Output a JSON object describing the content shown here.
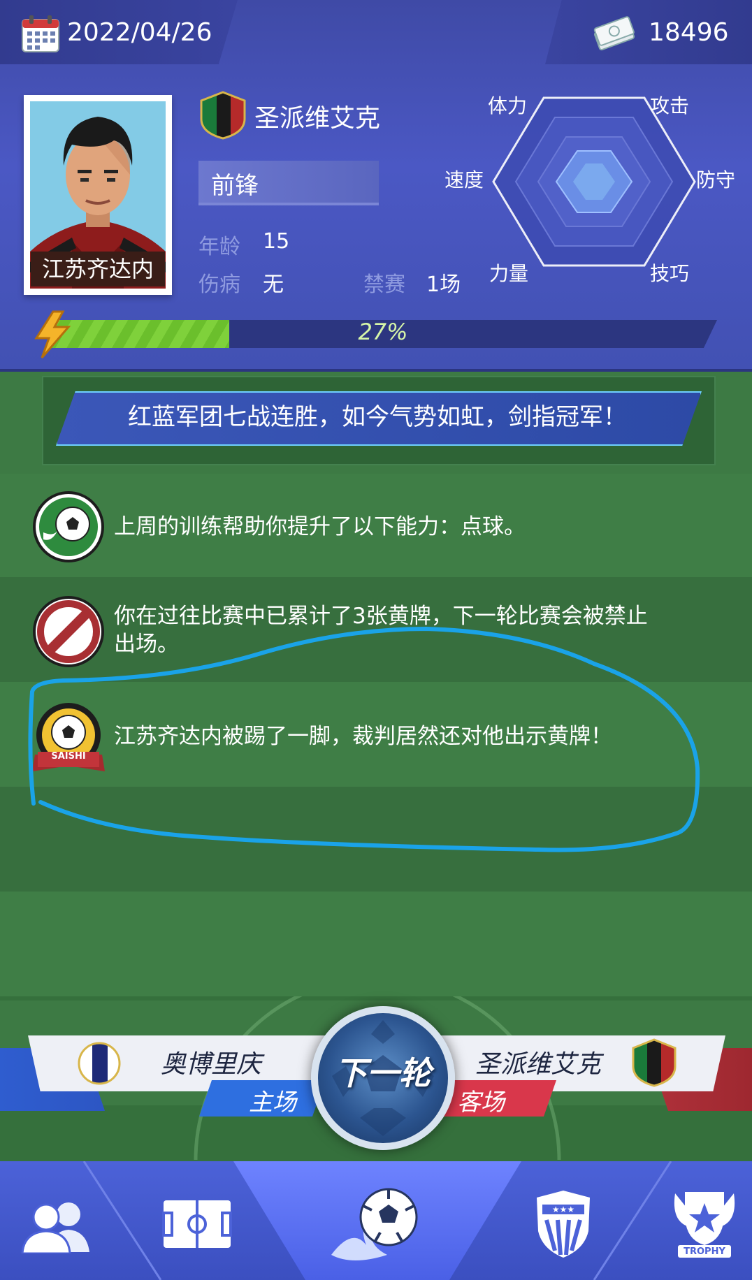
{
  "header": {
    "date": "2022/04/26",
    "money": "18496",
    "player_name": "江苏齐达内",
    "team_name": "圣派维艾克",
    "position": "前锋",
    "age_label": "年龄",
    "age_value": "15",
    "injury_label": "伤病",
    "injury_value": "无",
    "ban_label": "禁赛",
    "ban_value": "1场",
    "progress_text": "27%",
    "progress_value": 27
  },
  "radar": {
    "labels": {
      "stamina": "体力",
      "attack": "攻击",
      "speed": "速度",
      "defense": "防守",
      "strength": "力量",
      "skill": "技巧"
    }
  },
  "banner": {
    "text": "红蓝军团七战连胜，如今气势如虹，剑指冠军！"
  },
  "messages": [
    {
      "icon": "soccer-ball-green-icon",
      "text": "上周的训练帮助你提升了以下能力：点球。"
    },
    {
      "icon": "no-entry-icon",
      "text": "你在过往比赛中已累计了3张黄牌，下一轮比赛会被禁止出场。"
    },
    {
      "icon": "saishi-badge-icon",
      "badge_text": "SAISHI",
      "text": "江苏齐达内被踢了一脚，裁判居然还对他出示黄牌！"
    }
  ],
  "match": {
    "home_team": "奥博里庆",
    "home_label": "主场",
    "away_team": "圣派维艾克",
    "away_label": "客场",
    "next_button": "下一轮"
  },
  "nav": {
    "trophy_text": "TROPHY"
  },
  "colors": {
    "header_blue": "#4b58c4",
    "progress_green": "#7fd13b",
    "home_blue": "#2e6fe0",
    "away_red": "#d9374b",
    "annotation_cyan": "#1aa3e8"
  }
}
